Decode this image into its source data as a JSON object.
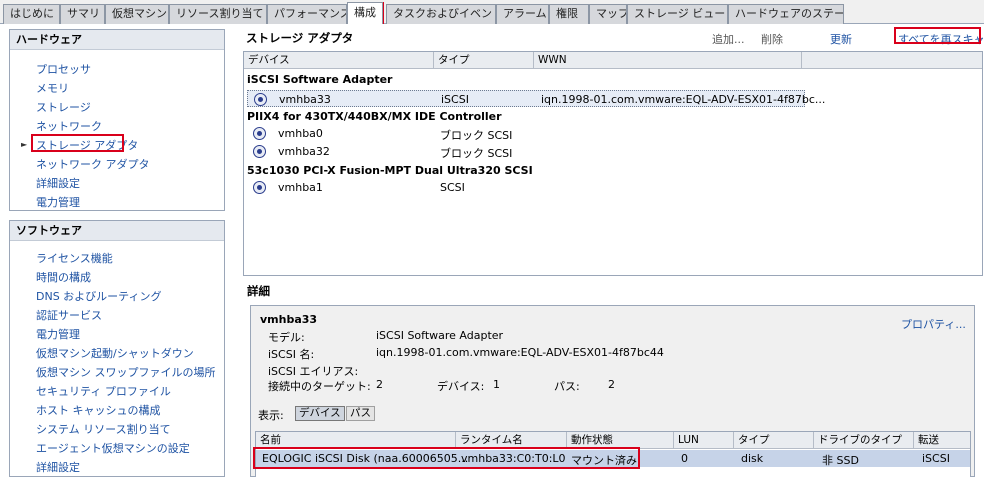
{
  "tabs": [
    {
      "label": "はじめに"
    },
    {
      "label": "サマリ"
    },
    {
      "label": "仮想マシン"
    },
    {
      "label": "リソース割り当て"
    },
    {
      "label": "パフォーマンス"
    },
    {
      "label": "構成"
    },
    {
      "label": "タスクおよびイベント"
    },
    {
      "label": "アラーム"
    },
    {
      "label": "権限"
    },
    {
      "label": "マップ"
    },
    {
      "label": "ストレージ ビュー"
    },
    {
      "label": "ハードウェアのステータス"
    }
  ],
  "hardware": {
    "title": "ハードウェア",
    "items": [
      "プロセッサ",
      "メモリ",
      "ストレージ",
      "ネットワーク",
      "ストレージ アダプタ",
      "ネットワーク アダプタ",
      "詳細設定",
      "電力管理"
    ]
  },
  "software": {
    "title": "ソフトウェア",
    "items": [
      "ライセンス機能",
      "時間の構成",
      "DNS およびルーティング",
      "認証サービス",
      "電力管理",
      "仮想マシン起動/シャットダウン",
      "仮想マシン スワップファイルの場所",
      "セキュリティ プロファイル",
      "ホスト キャッシュの構成",
      "システム リソース割り当て",
      "エージェント仮想マシンの設定",
      "詳細設定"
    ]
  },
  "adapters": {
    "title": "ストレージ アダプタ",
    "add": "追加...",
    "remove": "削除",
    "refresh": "更新",
    "rescan_all": "すべてを再スキャン",
    "columns": [
      "デバイス",
      "タイプ",
      "WWN"
    ],
    "groups": [
      {
        "name": "iSCSI Software Adapter",
        "rows": [
          {
            "device": "vmhba33",
            "type": "iSCSI",
            "wwn": "iqn.1998-01.com.vmware:EQL-ADV-ESX01-4f87bc..."
          }
        ]
      },
      {
        "name": "PIIX4 for 430TX/440BX/MX IDE Controller",
        "rows": [
          {
            "device": "vmhba0",
            "type": "ブロック SCSI",
            "wwn": ""
          },
          {
            "device": "vmhba32",
            "type": "ブロック SCSI",
            "wwn": ""
          }
        ]
      },
      {
        "name": "53c1030 PCI-X Fusion-MPT Dual Ultra320 SCSI",
        "rows": [
          {
            "device": "vmhba1",
            "type": "SCSI",
            "wwn": ""
          }
        ]
      }
    ]
  },
  "details": {
    "title": "詳細",
    "name": "vmhba33",
    "properties": "プロパティ...",
    "model_label": "モデル:",
    "model_value": "iSCSI Software Adapter",
    "iscsi_name_label": "iSCSI 名:",
    "iscsi_name_value": "iqn.1998-01.com.vmware:EQL-ADV-ESX01-4f87bc44",
    "iscsi_alias_label": "iSCSI エイリアス:",
    "targets_label": "接続中のターゲット:",
    "targets_value": "2",
    "devices_label": "デバイス:",
    "devices_value": "1",
    "paths_label": "パス:",
    "paths_value": "2",
    "view_label": "表示:",
    "view_devices": "デバイス",
    "view_paths": "パス",
    "columns": [
      "名前",
      "ランタイム名",
      "動作状態",
      "LUN",
      "タイプ",
      "ドライブのタイプ",
      "転送"
    ],
    "row": {
      "name": "EQLOGIC iSCSI Disk (naa.60006505...",
      "runtime": "vmhba33:C0:T0:L0",
      "state": "マウント済み",
      "lun": "0",
      "type": "disk",
      "drive_type": "非 SSD",
      "transport": "iSCSI"
    }
  },
  "colors": {
    "accent": "#1f53a3",
    "highlight": "#d9001b",
    "selection": "#c6d3e8"
  }
}
